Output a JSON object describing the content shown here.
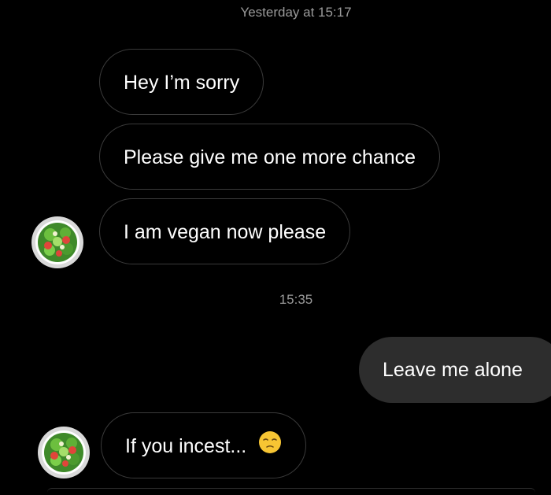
{
  "chat": {
    "timestamps": [
      "Yesterday at 15:17",
      "15:35"
    ],
    "messages": [
      {
        "text": "Hey I’m sorry",
        "direction": "incoming"
      },
      {
        "text": "Please give me one more chance",
        "direction": "incoming"
      },
      {
        "text": "I am vegan now please",
        "direction": "incoming"
      },
      {
        "text": "Leave me alone",
        "direction": "outgoing"
      },
      {
        "text": "If you incest...",
        "direction": "incoming",
        "emoji": "pensive-face-emoji"
      }
    ],
    "avatar_icon": "salad-bowl-icon"
  },
  "colors": {
    "background": "#000000",
    "incoming_border": "#3a3a3a",
    "outgoing_fill": "#2d2d2d",
    "timestamp_text": "#9a9a9a"
  }
}
